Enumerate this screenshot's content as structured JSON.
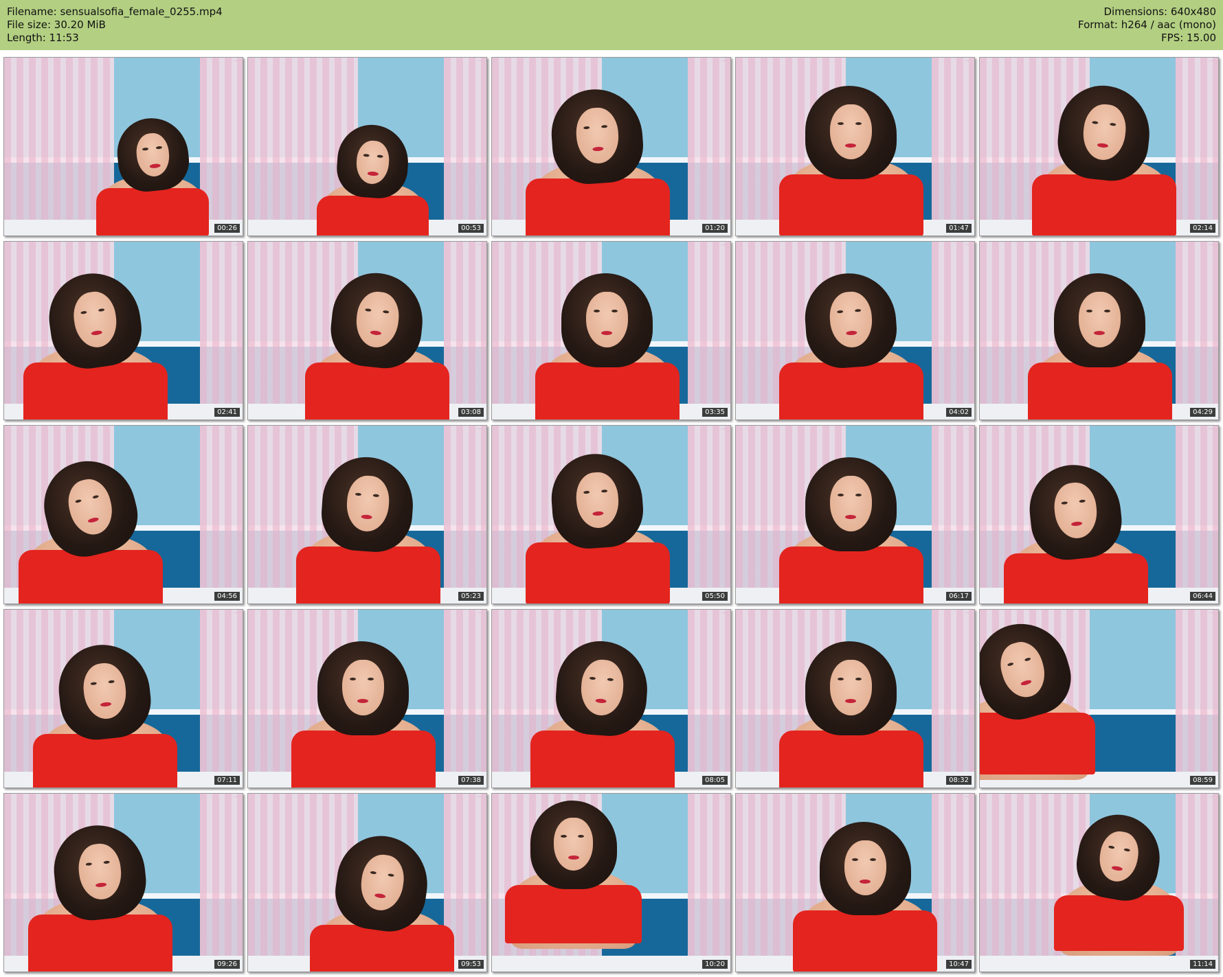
{
  "header": {
    "filename": "Filename: sensualsofia_female_0255.mp4",
    "file_size": "File size: 30.20 MiB",
    "length": "Length: 11:53",
    "dimensions": "Dimensions: 640x480",
    "format": "Format: h264 / aac (mono)",
    "fps": "FPS: 15.00",
    "bar_color": "#b3cf82"
  },
  "thumbnails": [
    {
      "timestamp": "00:26"
    },
    {
      "timestamp": "00:53"
    },
    {
      "timestamp": "01:20"
    },
    {
      "timestamp": "01:47"
    },
    {
      "timestamp": "02:14"
    },
    {
      "timestamp": "02:41"
    },
    {
      "timestamp": "03:08"
    },
    {
      "timestamp": "03:35"
    },
    {
      "timestamp": "04:02"
    },
    {
      "timestamp": "04:29"
    },
    {
      "timestamp": "04:56"
    },
    {
      "timestamp": "05:23"
    },
    {
      "timestamp": "05:50"
    },
    {
      "timestamp": "06:17"
    },
    {
      "timestamp": "06:44"
    },
    {
      "timestamp": "07:11"
    },
    {
      "timestamp": "07:38"
    },
    {
      "timestamp": "08:05"
    },
    {
      "timestamp": "08:32"
    },
    {
      "timestamp": "08:59"
    },
    {
      "timestamp": "09:26"
    },
    {
      "timestamp": "09:53"
    },
    {
      "timestamp": "10:20"
    },
    {
      "timestamp": "10:47"
    },
    {
      "timestamp": "11:14"
    }
  ],
  "colors": {
    "dress": "#e4241e",
    "wall": "#8ec6de",
    "panel": "#16689a",
    "curtain": "#eec4d6"
  }
}
